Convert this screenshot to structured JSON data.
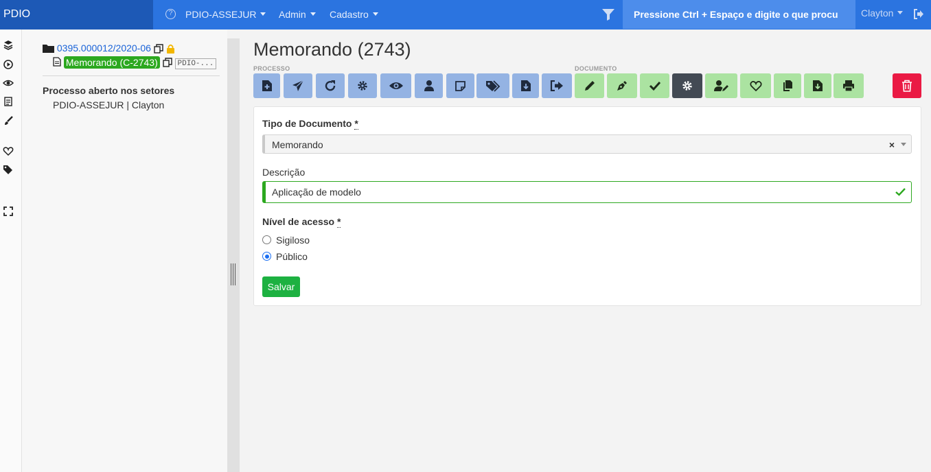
{
  "topbar": {
    "brand": "PDIO",
    "help_icon_glyph": "?",
    "nav": [
      "PDIO-ASSEJUR",
      "Admin",
      "Cadastro"
    ],
    "search_placeholder": "Pressione Ctrl + Espaço e digite o que procu",
    "user": "Clayton"
  },
  "rail": {
    "icons": [
      "layers-icon",
      "play-circle-icon",
      "eye-icon",
      "calendar-icon",
      "brush-icon",
      "heart-icon",
      "tags-icon",
      "expand-icon"
    ]
  },
  "tree": {
    "process_number": "0395.000012/2020-06",
    "document_label": "Memorando (C-2743)",
    "document_sector_tag": "PDIO-...",
    "sectors_title": "Processo aberto nos setores",
    "sectors_item": "PDIO-ASSEJUR | Clayton"
  },
  "main": {
    "title": "Memorando (2743)",
    "group_process_label": "PROCESSO",
    "group_document_label": "DOCUMENTO",
    "process_buttons": [
      "file-plus-icon",
      "send-icon",
      "redo-icon",
      "gear-icon",
      "eye-icon",
      "user-icon",
      "sticky-note-icon",
      "tags-icon",
      "file-download-icon",
      "sign-out-icon"
    ],
    "document_buttons": [
      "pencil-icon",
      "pen-nib-icon",
      "check-icon",
      "gear-icon",
      "user-edit-icon",
      "heart-icon",
      "copy-icon",
      "file-download-icon",
      "print-icon"
    ],
    "delete_icon": "trash-icon",
    "colors": {
      "process_btn": "#94b3e3",
      "document_btn": "#abe3a1",
      "active_btn": "#434a54",
      "delete_btn": "#ea1a44",
      "success": "#1db141"
    }
  },
  "form": {
    "tipo_label": "Tipo de Documento",
    "required_mark": "*",
    "tipo_value": "Memorando",
    "tipo_clear": "×",
    "descricao_label": "Descrição",
    "descricao_value": "Aplicação de modelo",
    "nivel_label": "Nível de acesso",
    "options": [
      "Sigiloso",
      "Público"
    ],
    "selected_option": "Público",
    "save_label": "Salvar"
  }
}
